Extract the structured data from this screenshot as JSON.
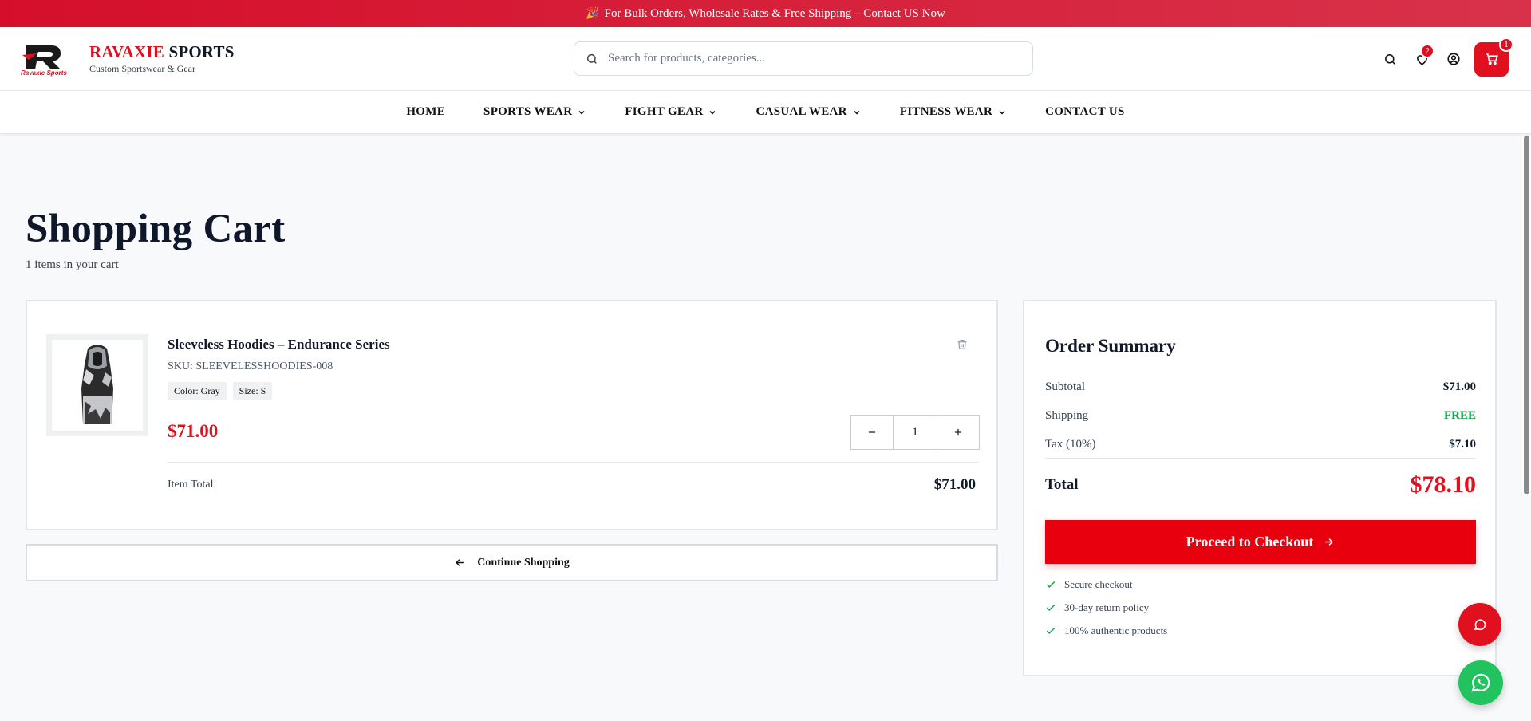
{
  "promo": {
    "icon": "🎉",
    "text": "For Bulk Orders, Wholesale Rates & Free Shipping – Contact US Now"
  },
  "brand": {
    "name_red": "RAVAXIE",
    "name_dark": " SPORTS",
    "tagline": "Custom Sportswear & Gear",
    "logo_text": "Ravaxie Sports"
  },
  "search": {
    "placeholder": "Search for products, categories..."
  },
  "header": {
    "wishlist_count": "2",
    "cart_count": "1"
  },
  "nav": [
    {
      "label": "HOME"
    },
    {
      "label": "SPORTS WEAR"
    },
    {
      "label": "FIGHT GEAR"
    },
    {
      "label": "CASUAL WEAR"
    },
    {
      "label": "FITNESS WEAR"
    },
    {
      "label": "CONTACT US"
    }
  ],
  "page": {
    "title": "Shopping Cart",
    "subtitle": "1 items in your cart"
  },
  "cart_item": {
    "name": "Sleeveless Hoodies – Endurance Series",
    "sku": "SKU: SLEEVELESSHOODIES-008",
    "color_tag": "Color: Gray",
    "size_tag": "Size: S",
    "price": "$71.00",
    "quantity": "1",
    "item_total_label": "Item Total:",
    "item_total_value": "$71.00"
  },
  "continue_label": "Continue Shopping",
  "summary": {
    "title": "Order Summary",
    "subtotal_label": "Subtotal",
    "subtotal_value": "$71.00",
    "shipping_label": "Shipping",
    "shipping_value": "FREE",
    "tax_label": "Tax (10%)",
    "tax_value": "$7.10",
    "total_label": "Total",
    "total_value": "$78.10",
    "checkout_label": "Proceed to Checkout",
    "bullets": [
      "Secure checkout",
      "30-day return policy",
      "100% authentic products"
    ]
  },
  "colors": {
    "accent": "#e1101e",
    "success": "#16a34a",
    "whatsapp": "#22c35e"
  }
}
